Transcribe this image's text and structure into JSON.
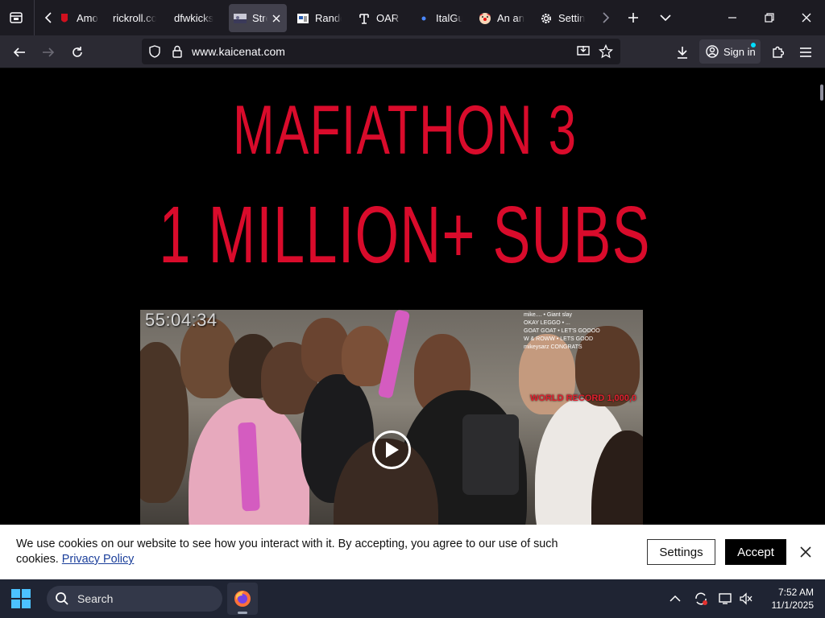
{
  "browser": {
    "tabs": [
      {
        "title": "Amog",
        "favicon": "red-shield-icon",
        "active": false
      },
      {
        "title": "rickroll.com",
        "favicon": "",
        "active": false
      },
      {
        "title": "dfwkicks",
        "favicon": "",
        "active": false
      },
      {
        "title": "Stre",
        "favicon": "stream-thumbnail-icon",
        "active": true
      },
      {
        "title": "Rando",
        "favicon": "window-icon",
        "active": false
      },
      {
        "title": "OAR D",
        "favicon": "oar-icon",
        "active": false
      },
      {
        "title": "ItalGu",
        "favicon": "blue-dot-icon",
        "active": false
      },
      {
        "title": "An an",
        "favicon": "clown-icon",
        "active": false
      },
      {
        "title": "Settin",
        "favicon": "gear-icon",
        "active": false
      }
    ],
    "url": "www.kaicenat.com",
    "sign_in_label": "Sign in"
  },
  "page": {
    "hero_line1": "MAFIATHON 3",
    "hero_line2": "1 MILLION+ SUBS",
    "video": {
      "timer": "55:04:34",
      "overlay_text": "WORLD RECORD 1,000,0",
      "chat_lines": [
        "mike.... • Giant slay",
        "OKAY LEGGO • ...",
        "GOAT GOAT • LET'S GOOOO",
        "W & ROWW • LETS GOOD",
        "mikeysarz CONGRATS"
      ]
    }
  },
  "cookie_banner": {
    "text": "We use cookies on our website to see how you interact with it. By accepting, you agree to our use of such cookies.",
    "privacy_link": "Privacy Policy",
    "settings_label": "Settings",
    "accept_label": "Accept"
  },
  "taskbar": {
    "search_label": "Search",
    "time": "7:52 AM",
    "date": "11/1/2025"
  },
  "colors": {
    "hero_red": "#d90b2b",
    "tab_strip": "#1c1b22",
    "nav_bar": "#2b2a33",
    "taskbar": "#1f2433"
  }
}
